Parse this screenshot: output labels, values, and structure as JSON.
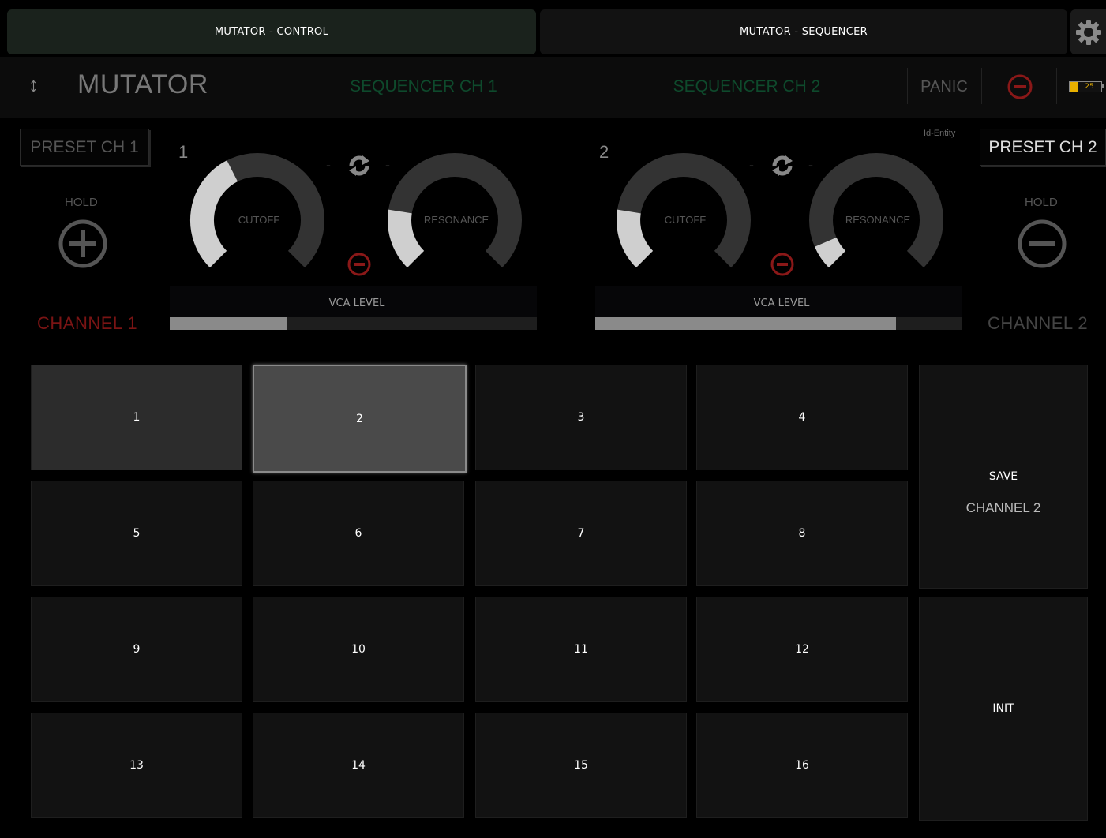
{
  "tabs": {
    "control": "MUTATOR - CONTROL",
    "sequencer": "MUTATOR - SEQUENCER"
  },
  "header": {
    "title": "MUTATOR",
    "seq1": "SEQUENCER CH 1",
    "seq2": "SEQUENCER CH 2",
    "panic": "PANIC",
    "battery": "25"
  },
  "channel1": {
    "preset": "PRESET CH 1",
    "number": "1",
    "hold": "HOLD",
    "cutoff_label": "CUTOFF",
    "resonance_label": "RESONANCE",
    "cutoff_level": 0.4,
    "resonance_level": 0.2,
    "vca_label": "VCA LEVEL",
    "vca_level": 0.32,
    "name": "CHANNEL 1",
    "separator_left": "-",
    "separator_right": "-"
  },
  "channel2": {
    "preset": "PRESET CH 2",
    "number": "2",
    "hold": "HOLD",
    "cutoff_label": "CUTOFF",
    "resonance_label": "RESONANCE",
    "cutoff_level": 0.2,
    "resonance_level": 0.08,
    "vca_label": "VCA LEVEL",
    "vca_level": 0.82,
    "name": "CHANNEL 2",
    "separator_left": "-",
    "separator_right": "-"
  },
  "id_entity": "Id-Entity",
  "pads": [
    "1",
    "2",
    "3",
    "4",
    "5",
    "6",
    "7",
    "8",
    "9",
    "10",
    "11",
    "12",
    "13",
    "14",
    "15",
    "16"
  ],
  "save": {
    "label": "SAVE",
    "channel": "CHANNEL 2"
  },
  "init": "INIT",
  "colors": {
    "accent_green": "#0e4a2c",
    "channel1_red": "#7a1414",
    "minus_red": "#8a1818"
  }
}
